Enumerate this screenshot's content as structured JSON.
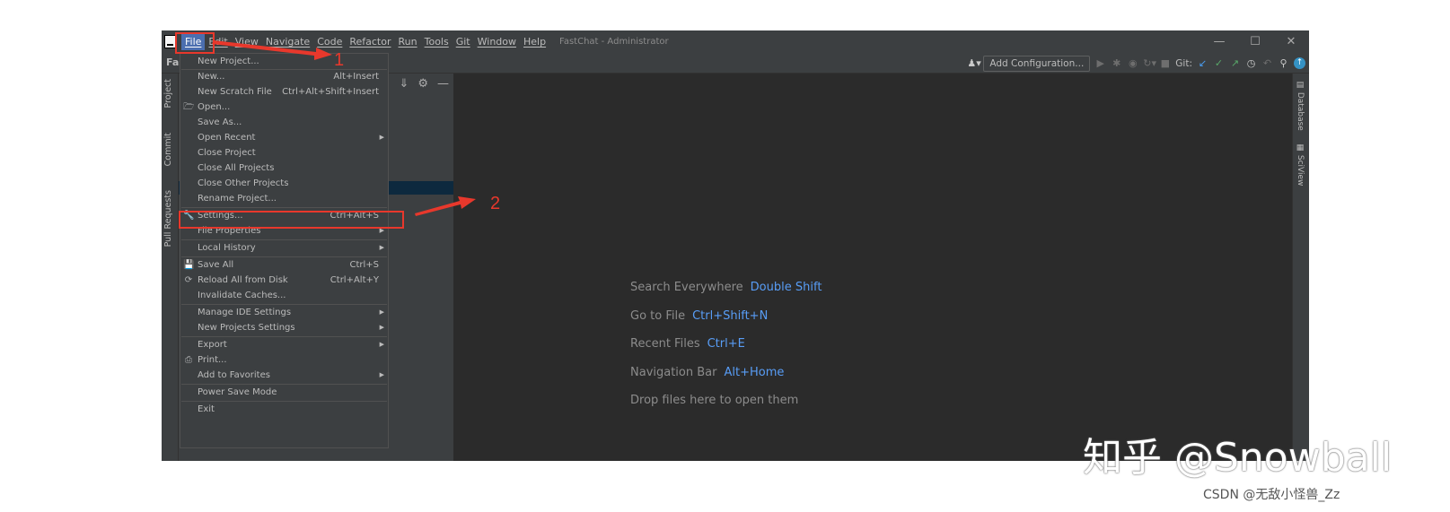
{
  "window": {
    "title": "FastChat - Administrator",
    "project_crumb": "Fas",
    "controls": [
      "—",
      "☐",
      "✕"
    ]
  },
  "menubar": {
    "items": [
      "File",
      "Edit",
      "View",
      "Navigate",
      "Code",
      "Refactor",
      "Run",
      "Tools",
      "Git",
      "Window",
      "Help"
    ],
    "active": "File"
  },
  "toolbar": {
    "add_config_label": "Add Configuration...",
    "git_label": "Git:"
  },
  "left_tabs": [
    "Project",
    "Commit",
    "Pull Requests"
  ],
  "right_tabs": [
    "Database",
    "SciView"
  ],
  "file_menu": {
    "items": [
      {
        "label": "New Project...",
        "shortcut": ""
      },
      {
        "label": "New...",
        "shortcut": "Alt+Insert"
      },
      {
        "label": "New Scratch File",
        "shortcut": "Ctrl+Alt+Shift+Insert"
      },
      {
        "label": "Open...",
        "shortcut": "",
        "icon": "folder-icon"
      },
      {
        "label": "Save As...",
        "shortcut": ""
      },
      {
        "label": "Open Recent",
        "shortcut": "",
        "submenu": true
      },
      {
        "label": "Close Project",
        "shortcut": ""
      },
      {
        "label": "Close All Projects",
        "shortcut": ""
      },
      {
        "label": "Close Other Projects",
        "shortcut": ""
      },
      {
        "label": "Rename Project...",
        "shortcut": ""
      },
      {
        "label": "Settings...",
        "shortcut": "Ctrl+Alt+S",
        "icon": "wrench-icon"
      },
      {
        "label": "File Properties",
        "shortcut": "",
        "submenu": true
      },
      {
        "label": "Local History",
        "shortcut": "",
        "submenu": true
      },
      {
        "label": "Save All",
        "shortcut": "Ctrl+S",
        "icon": "save-icon"
      },
      {
        "label": "Reload All from Disk",
        "shortcut": "Ctrl+Alt+Y",
        "icon": "reload-icon"
      },
      {
        "label": "Invalidate Caches...",
        "shortcut": ""
      },
      {
        "label": "Manage IDE Settings",
        "shortcut": "",
        "submenu": true
      },
      {
        "label": "New Projects Settings",
        "shortcut": "",
        "submenu": true
      },
      {
        "label": "Export",
        "shortcut": "",
        "submenu": true
      },
      {
        "label": "Print...",
        "shortcut": "",
        "icon": "print-icon"
      },
      {
        "label": "Add to Favorites",
        "shortcut": "",
        "submenu": true
      },
      {
        "label": "Power Save Mode",
        "shortcut": ""
      },
      {
        "label": "Exit",
        "shortcut": ""
      }
    ]
  },
  "editor_hints": [
    {
      "label": "Search Everywhere",
      "key": "Double Shift"
    },
    {
      "label": "Go to File",
      "key": "Ctrl+Shift+N"
    },
    {
      "label": "Recent Files",
      "key": "Ctrl+E"
    },
    {
      "label": "Navigation Bar",
      "key": "Alt+Home"
    },
    {
      "label": "Drop files here to open them",
      "key": ""
    }
  ],
  "annotations": {
    "step1": "1",
    "step2": "2",
    "accent_color": "#e8382c"
  },
  "watermarks": {
    "zhihu": "知乎 @Snowball",
    "csdn": "CSDN @无敌小怪兽_Zz"
  },
  "colors": {
    "ide_bg": "#2b2b2b",
    "panel_bg": "#3c3f41",
    "hint_key": "#589df6",
    "menu_active": "#4b6eaf"
  }
}
